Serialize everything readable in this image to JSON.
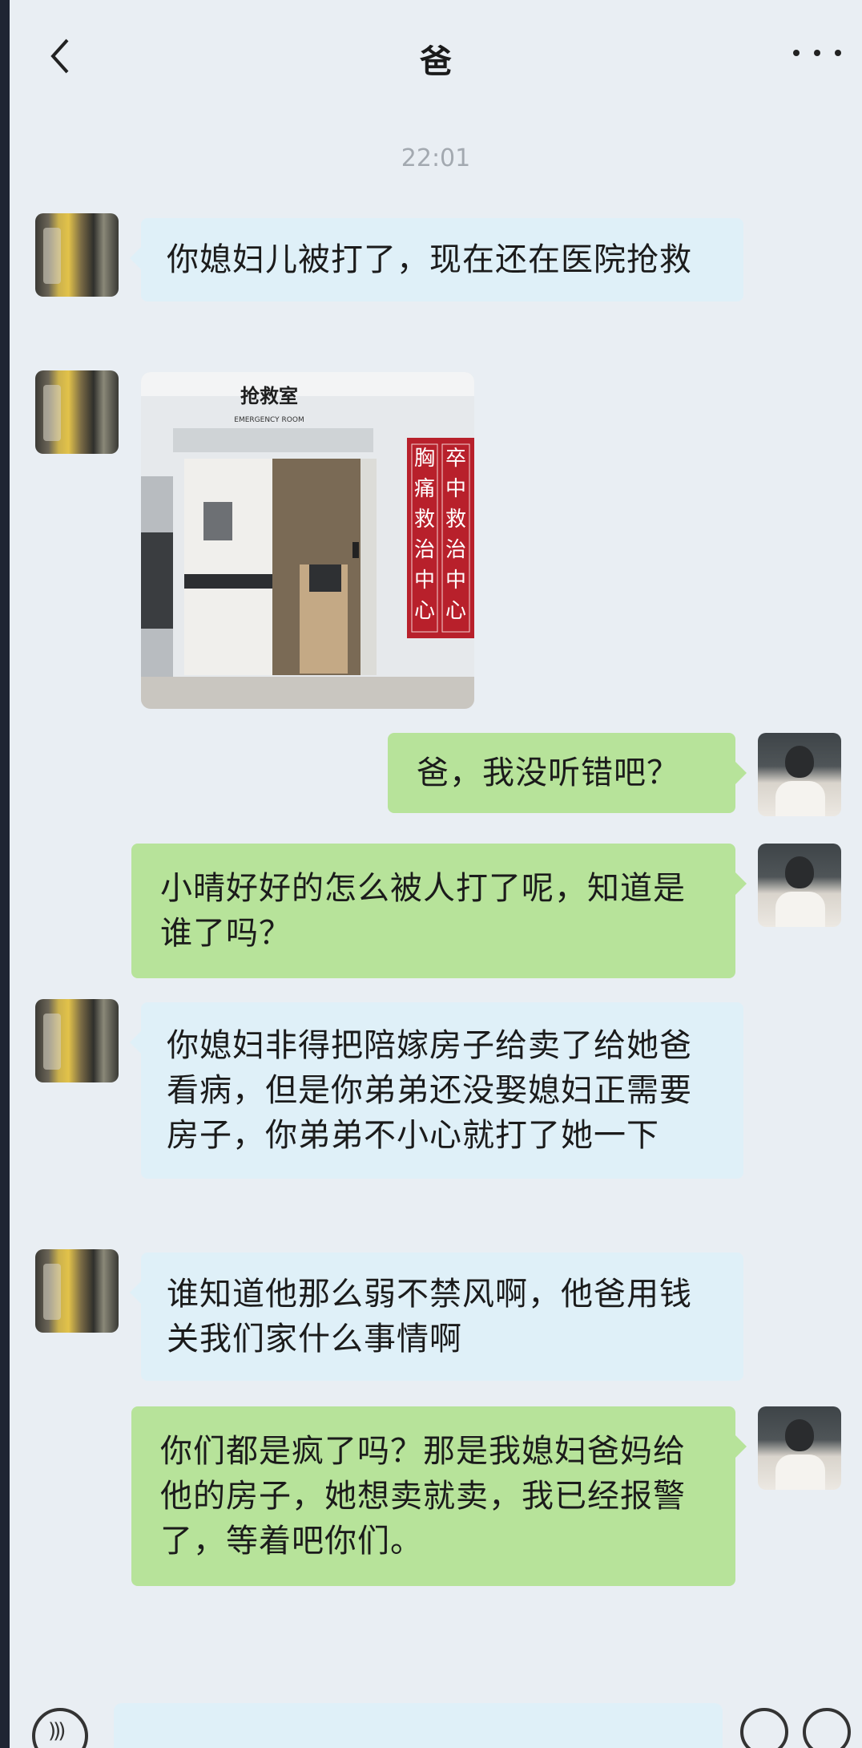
{
  "header": {
    "title": "爸",
    "back_icon": "chevron-left-icon",
    "more_icon": "more-horizontal-icon"
  },
  "timestamp": "22:01",
  "messages": [
    {
      "from": "dad",
      "type": "text",
      "text": "你媳妇儿被打了，现在还在医院抢救"
    },
    {
      "from": "dad",
      "type": "image",
      "sign": "抢救室",
      "sign_en": "EMERGENCY ROOM",
      "banner_left": "胸痛救治中心",
      "banner_right": "卒中救治中心"
    },
    {
      "from": "me",
      "type": "text",
      "text": "爸，我没听错吧？"
    },
    {
      "from": "me",
      "type": "text",
      "text": "小晴好好的怎么被人打了呢，知道是谁了吗？"
    },
    {
      "from": "dad",
      "type": "text",
      "text": "你媳妇非得把陪嫁房子给卖了给她爸看病，但是你弟弟还没娶媳妇正需要房子，你弟弟不小心就打了她一下"
    },
    {
      "from": "dad",
      "type": "text",
      "text": "谁知道他那么弱不禁风啊，他爸用钱关我们家什么事情啊"
    },
    {
      "from": "me",
      "type": "text",
      "text": "你们都是疯了吗？那是我媳妇爸妈给他的房子，她想卖就卖，我已经报警了，等着吧你们。"
    }
  ],
  "composer": {
    "voice_icon": "voice-icon",
    "emoji_icon": "emoji-icon",
    "plus_icon": "plus-icon"
  },
  "colors": {
    "background": "#e9eef3",
    "incoming_bubble": "#dff0f8",
    "outgoing_bubble": "#b7e39a"
  }
}
